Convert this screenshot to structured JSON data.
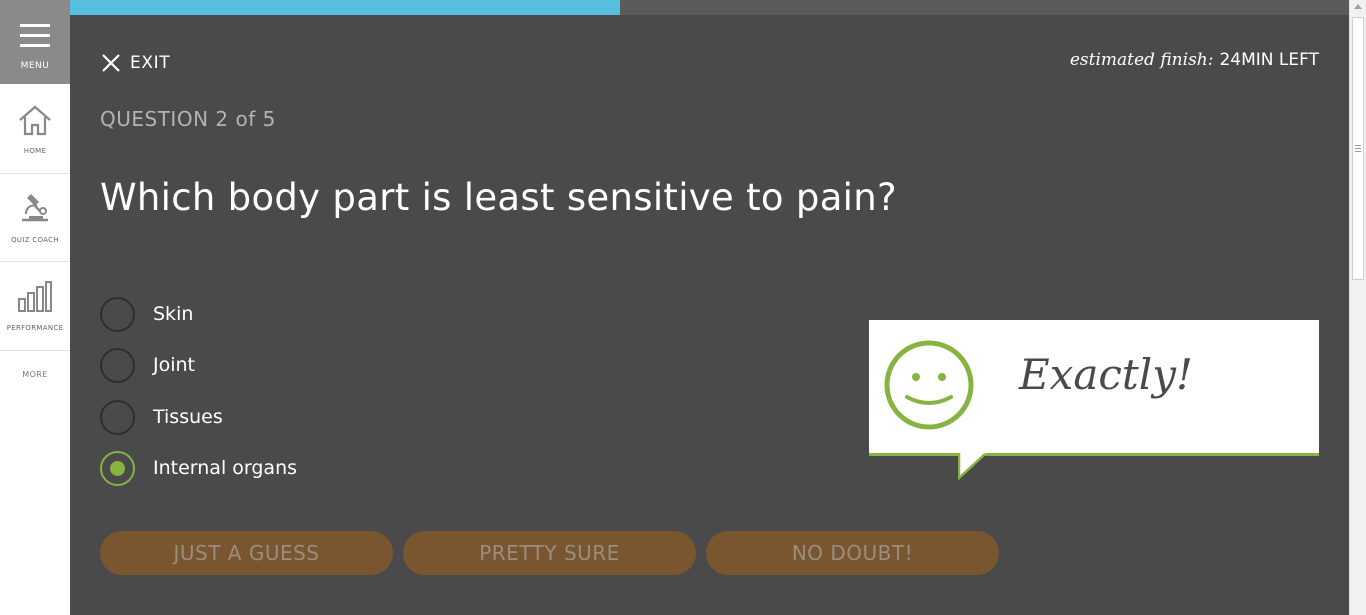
{
  "sidebar": {
    "menu_label": "MENU",
    "items": [
      {
        "label": "HOME",
        "icon": "home-icon"
      },
      {
        "label": "QUIZ COACH",
        "icon": "microscope-icon"
      },
      {
        "label": "PERFORMANCE",
        "icon": "bar-chart-icon"
      }
    ],
    "more_label": "MORE"
  },
  "progress": {
    "fraction": 0.43,
    "color": "#57bfe0"
  },
  "header": {
    "exit_label": "EXIT",
    "estimate_prefix": "estimated finish:",
    "estimate_value": "24MIN LEFT"
  },
  "question": {
    "number_label": "QUESTION 2 of 5",
    "text": "Which body part is least sensitive to pain?",
    "options": [
      "Skin",
      "Joint",
      "Tissues",
      "Internal organs"
    ],
    "selected_index": 3
  },
  "feedback": {
    "message": "Exactly!",
    "icon": "smiley-face-icon",
    "accent": "#86b341"
  },
  "confidence": {
    "guess_label": "JUST A GUESS",
    "sure_label": "PRETTY SURE",
    "doubt_label": "NO DOUBT!",
    "color": "#7a5630"
  }
}
